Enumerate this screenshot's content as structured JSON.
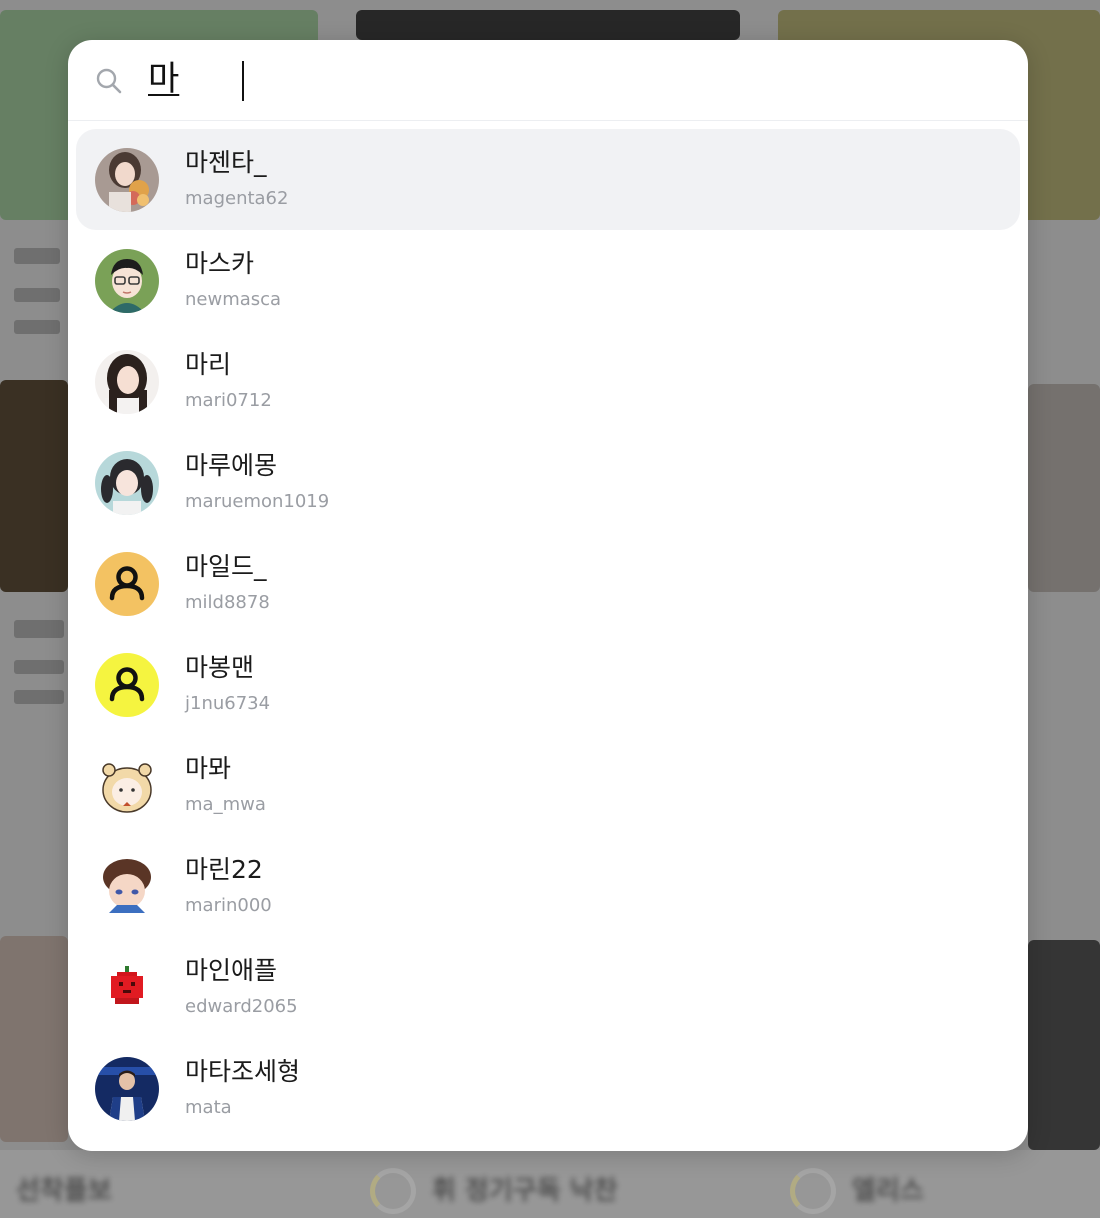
{
  "search": {
    "query": "마"
  },
  "results": [
    {
      "name": "마젠타_",
      "handle": "magenta62",
      "avatar_icon": "photo-avatar-woman-flowers"
    },
    {
      "name": "마스카",
      "handle": "newmasca",
      "avatar_icon": "cartoon-avatar-glasses-man"
    },
    {
      "name": "마리",
      "handle": "mari0712",
      "avatar_icon": "photo-avatar-woman"
    },
    {
      "name": "마루에몽",
      "handle": "maruemon1019",
      "avatar_icon": "photo-avatar-woman-twintails"
    },
    {
      "name": "마일드_",
      "handle": "mild8878",
      "avatar_icon": "default-user-icon",
      "avatar_color": "#f3c262"
    },
    {
      "name": "마봉맨",
      "handle": "j1nu6734",
      "avatar_icon": "default-user-icon",
      "avatar_color": "#f5f440"
    },
    {
      "name": "마뫄",
      "handle": "ma_mwa",
      "avatar_icon": "cartoon-avatar-hamster-girl"
    },
    {
      "name": "마린22",
      "handle": "marin000",
      "avatar_icon": "cartoon-avatar-boy"
    },
    {
      "name": "마인애플",
      "handle": "edward2065",
      "avatar_icon": "pixel-apple-avatar"
    },
    {
      "name": "마타조세형",
      "handle": "mata",
      "avatar_icon": "photo-avatar-man-stage"
    }
  ],
  "background": {
    "titles": [
      "선착플보",
      "휘 정기구독 낙찬",
      "엘리스"
    ]
  },
  "colors": {
    "active_row": "#f1f2f4",
    "name_text": "#1b1b1b",
    "handle_text": "#9a9da3",
    "panel": "#ffffff"
  }
}
